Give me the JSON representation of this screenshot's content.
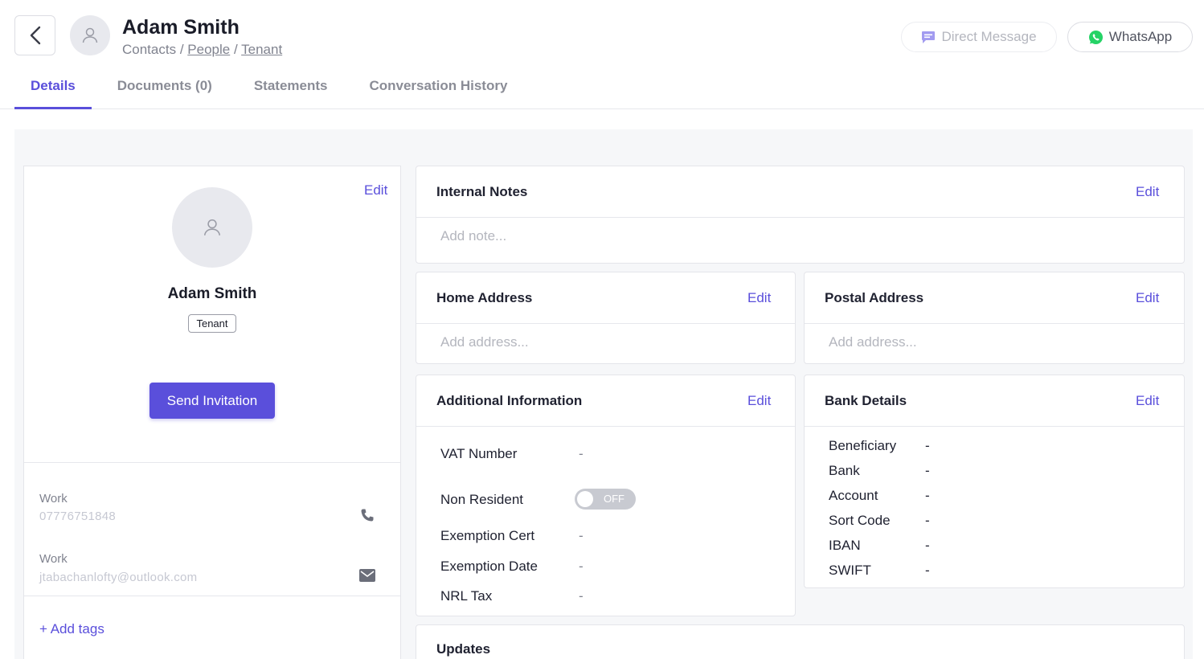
{
  "header": {
    "title": "Adam Smith",
    "breadcrumb": {
      "root": "Contacts",
      "sep": "/",
      "level1": "People",
      "level2": "Tenant"
    },
    "direct_message_label": "Direct Message",
    "whatsapp_label": "WhatsApp",
    "whatsapp_color": "#25D366",
    "accent_color": "#5A4FDB"
  },
  "tabs": [
    {
      "label": "Details",
      "active": true
    },
    {
      "label": "Documents (0)",
      "active": false
    },
    {
      "label": "Statements",
      "active": false
    },
    {
      "label": "Conversation History",
      "active": false
    }
  ],
  "profile": {
    "edit_label": "Edit",
    "name": "Adam Smith",
    "role_badge": "Tenant",
    "invite_label": "Send Invitation",
    "phone": {
      "label": "Work",
      "value": "07776751848"
    },
    "email": {
      "label": "Work",
      "value": "jtabachanlofty@outlook.com"
    },
    "add_tags_label": "+ Add tags"
  },
  "internal_notes": {
    "title": "Internal Notes",
    "edit_label": "Edit",
    "placeholder": "Add note..."
  },
  "home_address": {
    "title": "Home Address",
    "edit_label": "Edit",
    "placeholder": "Add address..."
  },
  "postal_address": {
    "title": "Postal Address",
    "edit_label": "Edit",
    "placeholder": "Add address..."
  },
  "additional_info": {
    "title": "Additional Information",
    "edit_label": "Edit",
    "vat_label": "VAT Number",
    "vat_value": "-",
    "non_resident_label": "Non Resident",
    "non_resident_toggle": "OFF",
    "exemption_cert_label": "Exemption Cert",
    "exemption_cert_value": "-",
    "exemption_date_label": "Exemption Date",
    "exemption_date_value": "-",
    "nrl_tax_label": "NRL Tax",
    "nrl_tax_value": "-"
  },
  "bank_details": {
    "title": "Bank Details",
    "edit_label": "Edit",
    "beneficiary_label": "Beneficiary",
    "beneficiary_value": "-",
    "bank_label": "Bank",
    "bank_value": "-",
    "account_label": "Account",
    "account_value": "-",
    "sort_code_label": "Sort Code",
    "sort_code_value": "-",
    "iban_label": "IBAN",
    "iban_value": "-",
    "swift_label": "SWIFT",
    "swift_value": "-"
  },
  "updates": {
    "title": "Updates"
  }
}
